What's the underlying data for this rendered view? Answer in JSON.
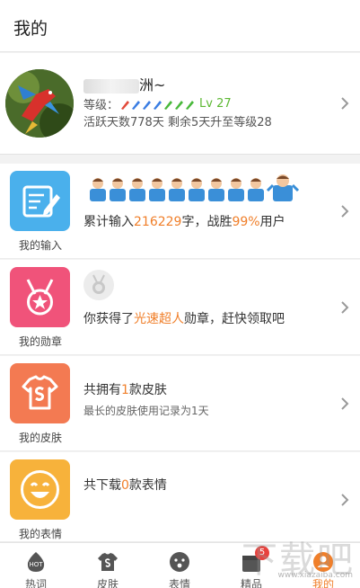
{
  "header": {
    "title": "我的"
  },
  "profile": {
    "username_tail": "洲~",
    "level_label": "等级：",
    "level_value": "Lv 27",
    "active_text": "活跃天数778天 剩余5天升至等级28"
  },
  "cards": {
    "input": {
      "label": "我的输入",
      "line_prefix": "累计输入",
      "chars": "216229",
      "line_mid": "字，战胜",
      "percent": "99%",
      "line_suffix": "用户"
    },
    "medal": {
      "label": "我的勋章",
      "prefix": "你获得了",
      "highlight": "光速超人",
      "suffix": "勋章，赶快领取吧"
    },
    "skin": {
      "label": "我的皮肤",
      "prefix": "共拥有",
      "count": "1",
      "suffix": "款皮肤",
      "sub": "最长的皮肤使用记录为1天"
    },
    "emoji": {
      "label": "我的表情",
      "prefix": "共下载",
      "count": "0",
      "suffix": "款表情"
    }
  },
  "tabs": [
    {
      "label": "热词",
      "icon": "hot-icon"
    },
    {
      "label": "皮肤",
      "icon": "tshirt-icon"
    },
    {
      "label": "表情",
      "icon": "face-icon"
    },
    {
      "label": "精品",
      "icon": "gift-icon",
      "badge": "5"
    },
    {
      "label": "我的",
      "icon": "user-icon",
      "active": true
    }
  ],
  "watermark": {
    "text": "下载吧",
    "url": "www.xiazaiba.com"
  },
  "colors": {
    "accent": "#f07f2a",
    "level_green": "#5cb833",
    "badge_red": "#e8423e"
  }
}
